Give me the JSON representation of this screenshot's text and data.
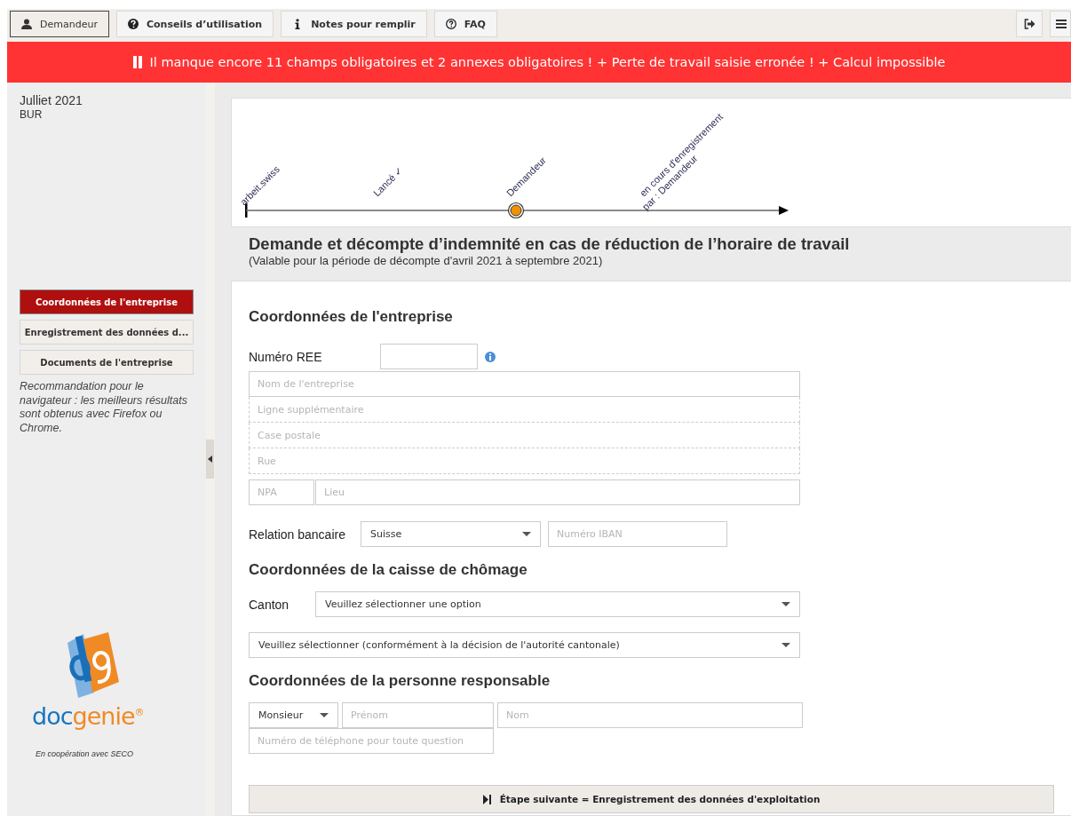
{
  "toolbar": {
    "buttons": [
      {
        "label": "Demandeur",
        "kind": "user",
        "selected": true
      },
      {
        "label": "Conseils d’utilisation",
        "kind": "help",
        "selected": false
      },
      {
        "label": "Notes pour remplir",
        "kind": "info",
        "selected": false
      },
      {
        "label": "FAQ",
        "kind": "faq",
        "selected": false
      }
    ]
  },
  "alert": {
    "text": "Il manque encore 11 champs obligatoires et 2 annexes obligatoires ! + Perte de travail saisie erronée ! + Calcul impossible"
  },
  "sidebar": {
    "period": "Julliet 2021",
    "code": "BUR",
    "nav": [
      {
        "label": "Coordonnées de l'entreprise",
        "selected": true
      },
      {
        "label": "Enregistrement des données d...",
        "selected": false
      },
      {
        "label": "Documents de l'entreprise",
        "selected": false
      }
    ],
    "note": "Recommandation pour le navigateur : les meilleurs résultats sont obtenus avec Firefox ou Chrome.",
    "logo": {
      "part_1": "doc",
      "part_2": "genie",
      "mark": "®"
    },
    "credit": "En coopération avec SECO"
  },
  "timeline": {
    "milestones": [
      {
        "lines": [
          "arbeit.swiss"
        ],
        "kind": "start"
      },
      {
        "lines": [
          "Lancé ✓"
        ],
        "kind": "step"
      },
      {
        "lines": [
          "Demandeur"
        ],
        "kind": "current"
      },
      {
        "lines": [
          "en cours d'enregistrement",
          "par : Demandeur"
        ],
        "kind": "step"
      }
    ]
  },
  "heading": {
    "title": "Demande et décompte d’indemnité en cas de réduction de l’horaire de travail",
    "subtitle": "(Valable pour la période de décompte d'avril 2021 à septembre 2021)"
  },
  "company": {
    "title": "Coordonnées de l'entreprise",
    "ree_label": "Numéro REE",
    "address": [
      {
        "placeholder": "Nom de l'entreprise"
      },
      {
        "placeholder": "Ligne supplémentaire"
      },
      {
        "placeholder": "Case postale"
      },
      {
        "placeholder": "Rue"
      }
    ],
    "npa": {
      "placeholder": "NPA"
    },
    "city": {
      "placeholder": "Lieu"
    },
    "bank_label": "Relation bancaire",
    "bank_country": "Suisse",
    "iban": {
      "placeholder": "Numéro IBAN"
    }
  },
  "fund": {
    "title": "Coordonnées de la caisse de chômage",
    "canton_label": "Canton",
    "canton": "Veuillez sélectionner une option",
    "fund_select": "Veuillez sélectionner (conformément à la décision de l'autorité cantonale)"
  },
  "person": {
    "title": "Coordonnées de la personne responsable",
    "salutation": "Monsieur",
    "first_name": {
      "placeholder": "Prénom"
    },
    "last_name": {
      "placeholder": "Nom"
    },
    "phone": {
      "placeholder": "Numéro de téléphone pour toute question"
    }
  },
  "next_button": "Étape suivante = Enregistrement des données d'exploitation"
}
